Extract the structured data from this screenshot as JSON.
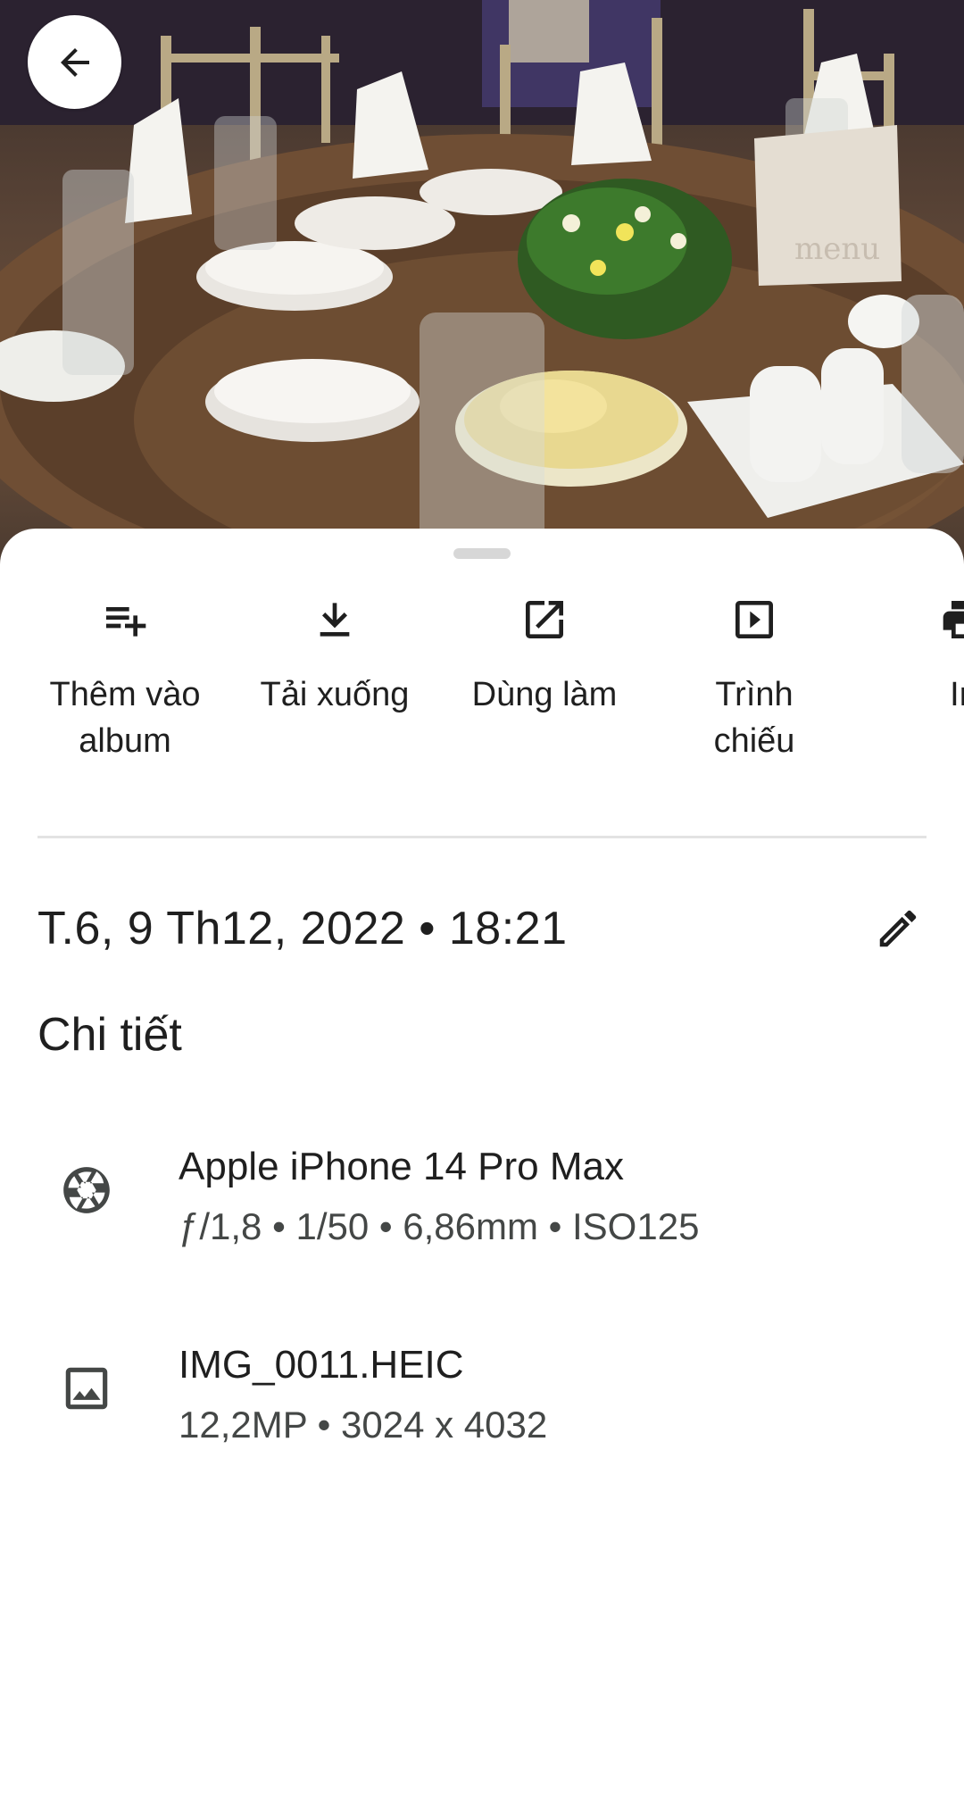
{
  "actions": [
    {
      "label": "Thêm vào\nalbum",
      "icon": "playlist-add-icon"
    },
    {
      "label": "Tải xuống",
      "icon": "download-icon"
    },
    {
      "label": "Dùng làm",
      "icon": "open-in-new-icon"
    },
    {
      "label": "Trình\nchiếu",
      "icon": "slideshow-icon"
    },
    {
      "label": "In",
      "icon": "print-icon"
    }
  ],
  "datetime": "T.6, 9 Th12, 2022  •  18:21",
  "details_title": "Chi tiết",
  "camera": {
    "title": "Apple iPhone 14 Pro Max",
    "subtitle": "ƒ/1,8  •  1/50  •  6,86mm  •  ISO125",
    "icon": "camera-aperture-icon"
  },
  "file": {
    "title": "IMG_0011.HEIC",
    "subtitle": "12,2MP  •  3024 x 4032",
    "icon": "image-icon"
  },
  "photo": {
    "sign_text": "menu"
  }
}
